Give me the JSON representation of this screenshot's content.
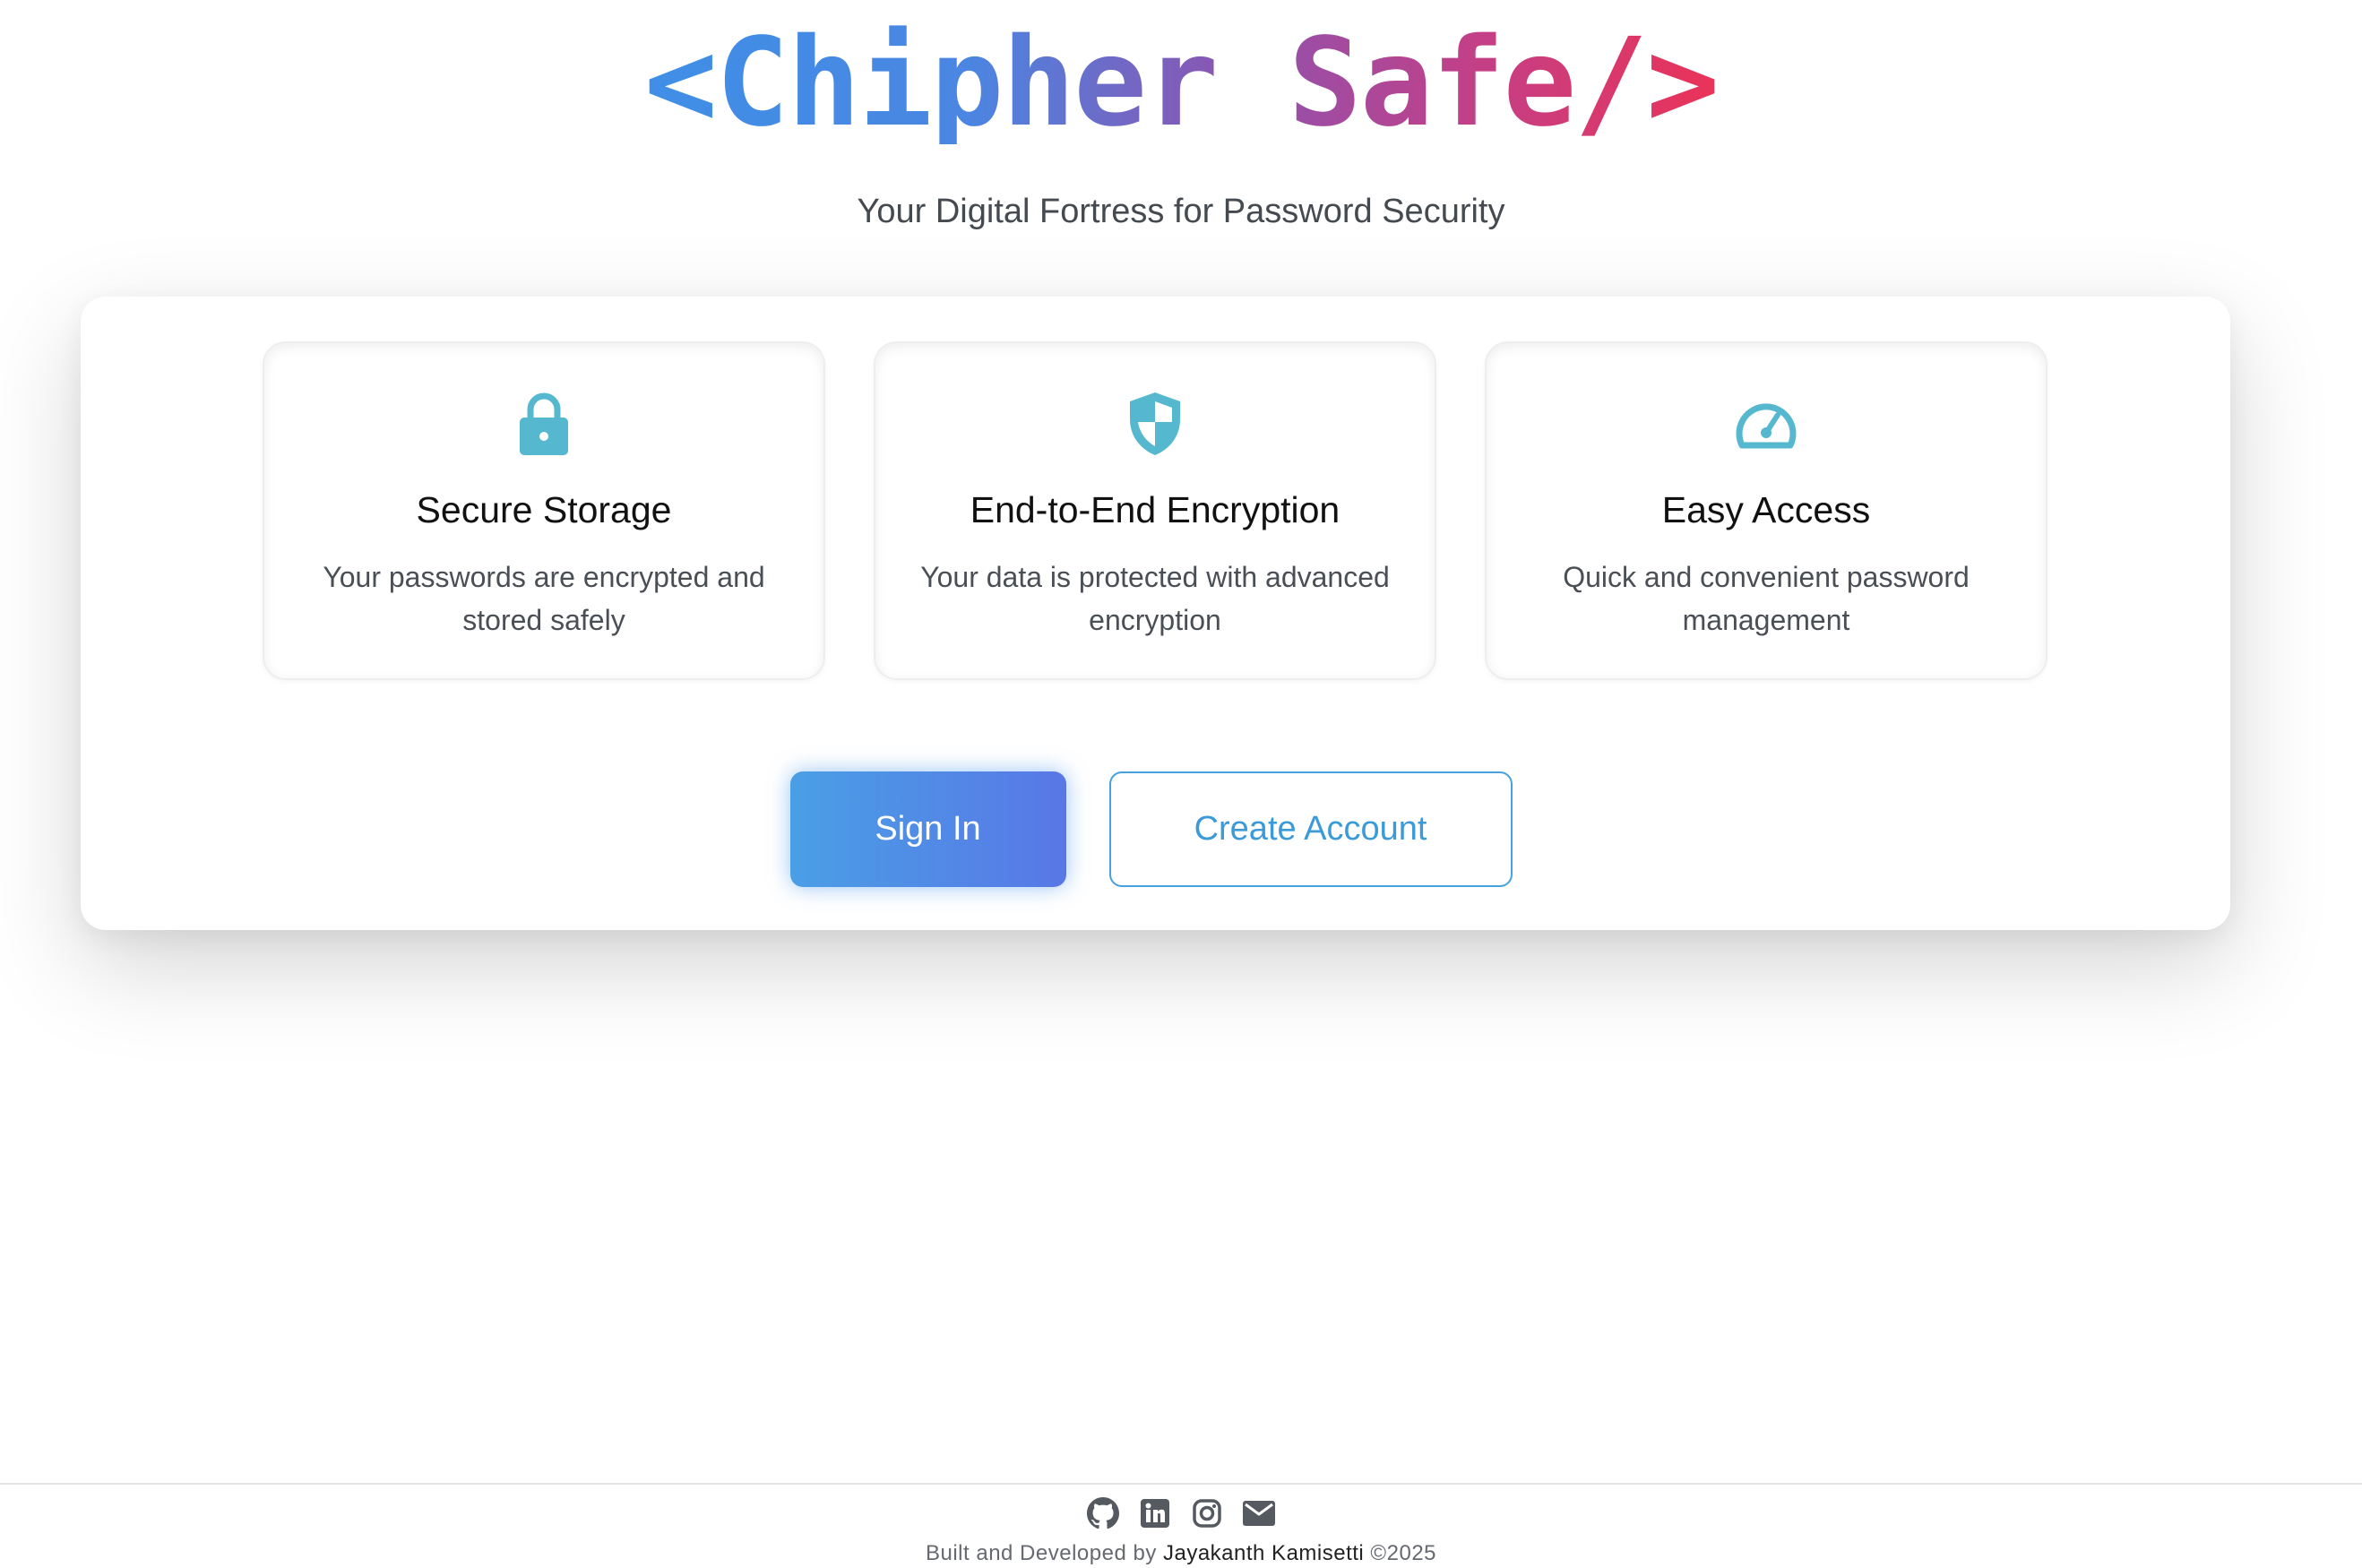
{
  "header": {
    "brand_title": "<Chipher Safe/>",
    "tagline": "Your Digital Fortress for Password Security"
  },
  "features": [
    {
      "icon": "lock-icon",
      "title": "Secure Storage",
      "description": "Your passwords are encrypted and stored safely"
    },
    {
      "icon": "shield-icon",
      "title": "End-to-End Encryption",
      "description": "Your data is protected with advanced encryption"
    },
    {
      "icon": "speedometer-icon",
      "title": "Easy Access",
      "description": "Quick and convenient password management"
    }
  ],
  "actions": {
    "sign_in_label": "Sign In",
    "create_account_label": "Create Account"
  },
  "footer": {
    "social_icons": [
      "github-icon",
      "linkedin-icon",
      "instagram-icon",
      "email-icon"
    ],
    "credit_prefix": "Built and Developed by ",
    "author": "Jayakanth Kamisetti",
    "credit_suffix": " ©2025"
  },
  "colors": {
    "accent_icon": "#56b8cf",
    "primary_button_start": "#4a9fe6",
    "primary_button_end": "#5877e6",
    "outline_button": "#44a2e0",
    "title_gradient_start": "#3f8fe6",
    "title_gradient_end": "#ea3358"
  }
}
